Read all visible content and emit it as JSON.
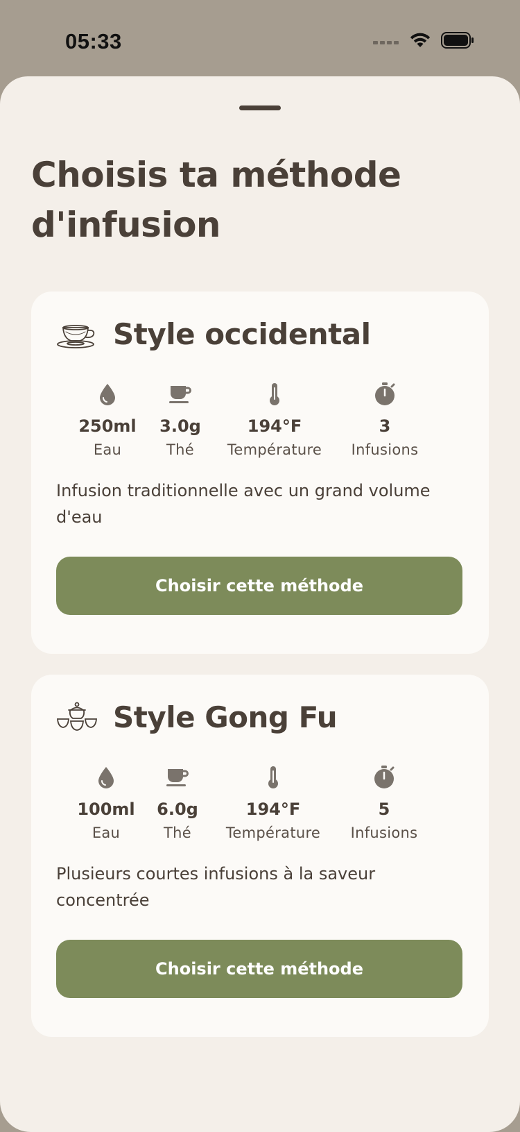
{
  "status_bar": {
    "time": "05:33"
  },
  "page": {
    "title": "Choisis ta méthode d'infusion"
  },
  "methods": [
    {
      "title": "Style occidental",
      "icon": "teacup-icon",
      "stats": [
        {
          "icon": "water-drop-icon",
          "value": "250ml",
          "label": "Eau"
        },
        {
          "icon": "tea-cup-icon",
          "value": "3.0g",
          "label": "Thé"
        },
        {
          "icon": "thermometer-icon",
          "value": "194°F",
          "label": "Température"
        },
        {
          "icon": "timer-icon",
          "value": "3",
          "label": "Infusions"
        }
      ],
      "description": "Infusion traditionnelle avec un grand volume d'eau",
      "button_label": "Choisir cette méthode"
    },
    {
      "title": "Style Gong Fu",
      "icon": "gongfu-set-icon",
      "stats": [
        {
          "icon": "water-drop-icon",
          "value": "100ml",
          "label": "Eau"
        },
        {
          "icon": "tea-cup-icon",
          "value": "6.0g",
          "label": "Thé"
        },
        {
          "icon": "thermometer-icon",
          "value": "194°F",
          "label": "Température"
        },
        {
          "icon": "timer-icon",
          "value": "5",
          "label": "Infusions"
        }
      ],
      "description": "Plusieurs courtes infusions à la saveur concentrée",
      "button_label": "Choisir cette méthode"
    }
  ],
  "colors": {
    "backdrop": "#a69d90",
    "sheet": "#f4efe9",
    "card": "#fcfaf7",
    "text": "#4a4038",
    "icon": "#7a736c",
    "button": "#7d8b5a"
  }
}
